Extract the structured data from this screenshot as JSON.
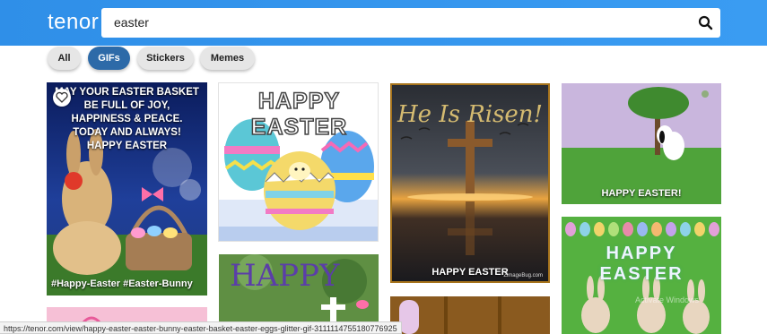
{
  "app": {
    "logo": "tenor"
  },
  "search": {
    "value": "easter",
    "icon": "search-icon"
  },
  "filters": [
    {
      "label": "All",
      "active": false
    },
    {
      "label": "GIFs",
      "active": true
    },
    {
      "label": "Stickers",
      "active": false
    },
    {
      "label": "Memes",
      "active": false
    }
  ],
  "tiles": {
    "t1": {
      "lines": [
        "MAY YOUR EASTER BASKET",
        "BE FULL OF JOY,",
        "HAPPINESS & PEACE.",
        "TODAY AND ALWAYS!",
        "HAPPY EASTER"
      ],
      "tags": "#Happy-Easter  #Easter-Bunny",
      "icon": "heart-icon"
    },
    "t2": {
      "title": "HAPPY EASTER"
    },
    "t3": {
      "title": "He Is Risen!",
      "caption": "HAPPY EASTER",
      "small": "ZimageBug.com"
    },
    "t4": {
      "caption": "HAPPY EASTER!"
    },
    "t5": {
      "title": "HAPPY"
    },
    "t7": {
      "title": "HAPPY EASTER"
    }
  },
  "status_url": "https://tenor.com/view/happy-easter-easter-bunny-easter-basket-easter-eggs-glitter-gif-3111114755180776925",
  "watermark": "Activate Windows",
  "colors": {
    "header": "#3a9cf2",
    "active_chip": "#2d6aa8"
  }
}
